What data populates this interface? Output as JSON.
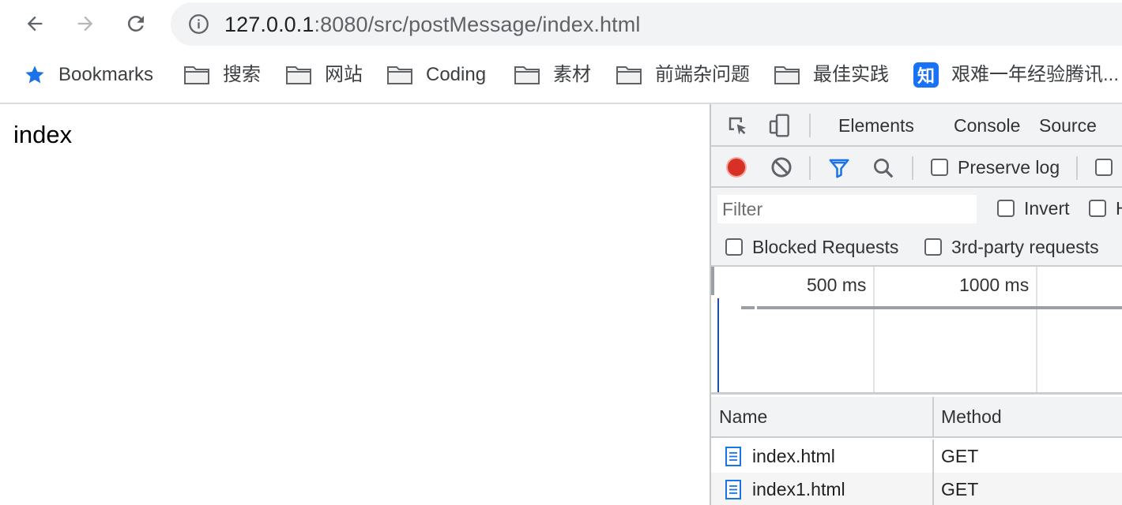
{
  "toolbar": {
    "url_host": "127.0.0.1",
    "url_rest": ":8080/src/postMessage/index.html"
  },
  "bookmarks": [
    {
      "label": "Bookmarks",
      "icon": "star-icon"
    },
    {
      "label": "搜索",
      "icon": "folder-icon"
    },
    {
      "label": "网站",
      "icon": "folder-icon"
    },
    {
      "label": "Coding",
      "icon": "folder-icon"
    },
    {
      "label": "素材",
      "icon": "folder-icon"
    },
    {
      "label": "前端杂问题",
      "icon": "folder-icon"
    },
    {
      "label": "最佳实践",
      "icon": "folder-icon"
    },
    {
      "label": "艰难一年经验腾讯...",
      "icon": "zhihu-icon",
      "icon_text": "知"
    }
  ],
  "page": {
    "text": "index"
  },
  "devtools": {
    "tabs": [
      "Elements",
      "Console",
      "Source"
    ],
    "preserve_log_label": "Preserve log",
    "filter_placeholder": "Filter",
    "invert_label": "Invert",
    "hide_label_partial": "H",
    "blocked_requests_label": "Blocked Requests",
    "third_party_label": "3rd-party requests",
    "timeline_labels": [
      "500 ms",
      "1000 ms"
    ],
    "columns": [
      "Name",
      "Method"
    ],
    "rows": [
      {
        "name": "index.html",
        "method": "GET"
      },
      {
        "name": "index1.html",
        "method": "GET"
      }
    ]
  },
  "colors": {
    "record": "#d93025",
    "filter_active": "#1a73e8",
    "star": "#1a73e8",
    "zhihu": "#1772f6",
    "timeline_marker": "#1f4fa8"
  }
}
